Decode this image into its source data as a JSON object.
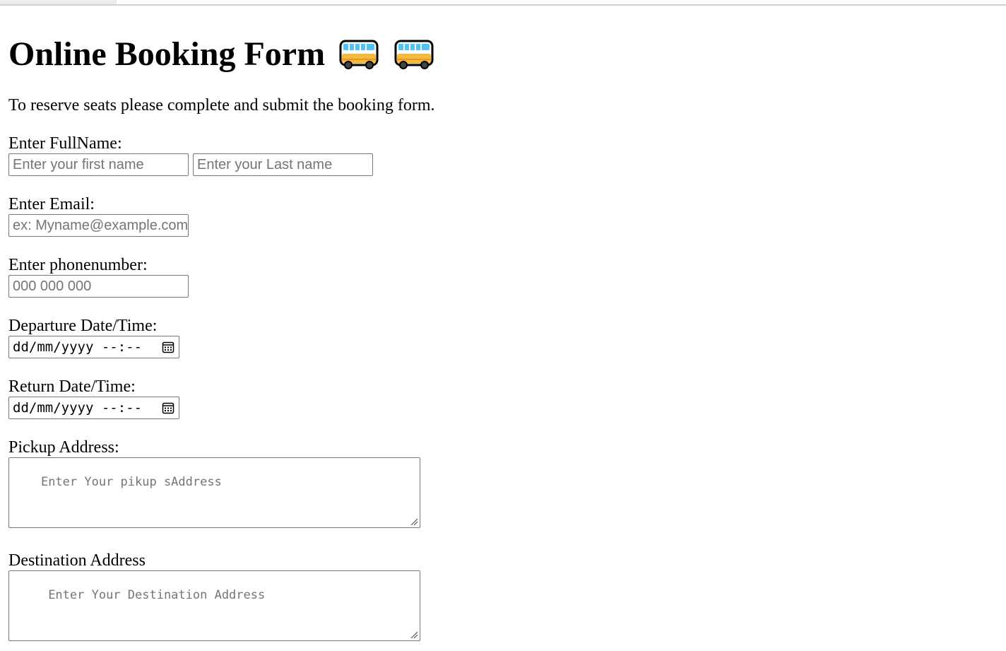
{
  "page": {
    "title": "Online Booking Form",
    "title_icons": [
      "bus-icon",
      "bus-icon"
    ],
    "intro": "To reserve seats please complete and submit the booking form."
  },
  "form": {
    "fullname": {
      "label": "Enter FullName:",
      "first_placeholder": "Enter your first name",
      "last_placeholder": "Enter your Last name"
    },
    "email": {
      "label": "Enter Email:",
      "placeholder": "ex: Myname@example.com"
    },
    "phone": {
      "label": "Enter phonenumber:",
      "placeholder": "000 000 000"
    },
    "departure": {
      "label": "Departure Date/Time:",
      "value": "dd/mm/yyyy --:--"
    },
    "return": {
      "label": "Return Date/Time:",
      "value": "dd/mm/yyyy --:--"
    },
    "pickup": {
      "label": "Pickup Address:",
      "placeholder": "Enter Your pikup sAddress"
    },
    "destination": {
      "label": "Destination Address",
      "placeholder": " Enter Your Destination Address"
    }
  },
  "colors": {
    "input_border": "#767676",
    "placeholder": "#757575",
    "bus_body": "#f4b942",
    "bus_window": "#4fc3f7"
  }
}
